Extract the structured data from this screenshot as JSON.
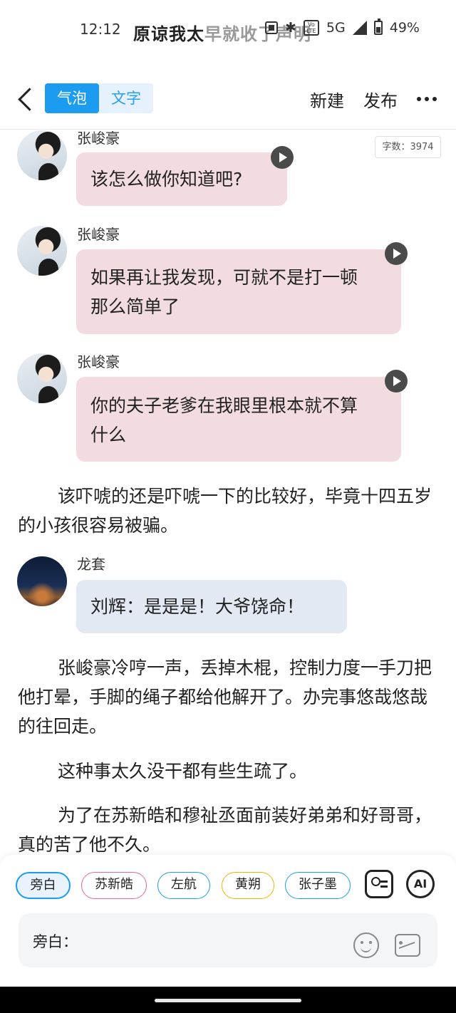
{
  "status_bar": {
    "time": "12:12",
    "notification_title_dark": "原谅我太",
    "notification_title_faded": "早就收了声明",
    "network": "5G",
    "volte": "Vo LTE",
    "battery": "49%"
  },
  "header": {
    "tabs": [
      {
        "label": "气泡",
        "active": true
      },
      {
        "label": "文字",
        "active": false
      }
    ],
    "new_label": "新建",
    "publish_label": "发布"
  },
  "word_count": "字数：3974",
  "messages": [
    {
      "speaker": "张峻豪",
      "text": "该怎么做你知道吧?",
      "avatar": "person-photo",
      "bubble_color": "#f2dcdf"
    },
    {
      "speaker": "张峻豪",
      "text_line1": "如果再让我发现，可就不是打一顿",
      "text_line2": "那么简单了",
      "avatar": "person-photo",
      "bubble_color": "#f2dcdf"
    },
    {
      "speaker": "张峻豪",
      "text_line1": "你的夫子老爹在我眼里根本就不算",
      "text_line2": "什么",
      "avatar": "person-photo",
      "bubble_color": "#f2dcdf"
    },
    {
      "speaker": "龙套",
      "text": "刘辉：是是是！大爷饶命！",
      "avatar": "night-scene",
      "bubble_color": "#e3e9f2"
    }
  ],
  "paragraphs": [
    "该吓唬的还是吓唬一下的比较好，毕竟十四五岁的小孩很容易被骗。",
    "张峻豪冷哼一声，丢掉木棍，控制力度一手刀把他打晕，手脚的绳子都给他解开了。办完事悠哉悠哉的往回走。",
    "这种事太久没干都有些生疏了。",
    "为了在苏新皓和穆祉丞面前装好弟弟和好哥哥，真的苦了他不久。"
  ],
  "characters": [
    {
      "label": "旁白",
      "color": "#1c9cf0",
      "active": true
    },
    {
      "label": "苏新皓",
      "color": "#e86a8a",
      "active": false
    },
    {
      "label": "左航",
      "color": "#1c9cf0",
      "active": false
    },
    {
      "label": "黄朔",
      "color": "#f0b400",
      "active": false
    },
    {
      "label": "张子墨",
      "color": "#1c9cf0",
      "active": false
    }
  ],
  "input": {
    "label": "旁白："
  },
  "icons": [
    "back-icon",
    "more-icon",
    "play-icon",
    "contact-icon",
    "ai-icon",
    "emoji-icon",
    "image-icon"
  ]
}
